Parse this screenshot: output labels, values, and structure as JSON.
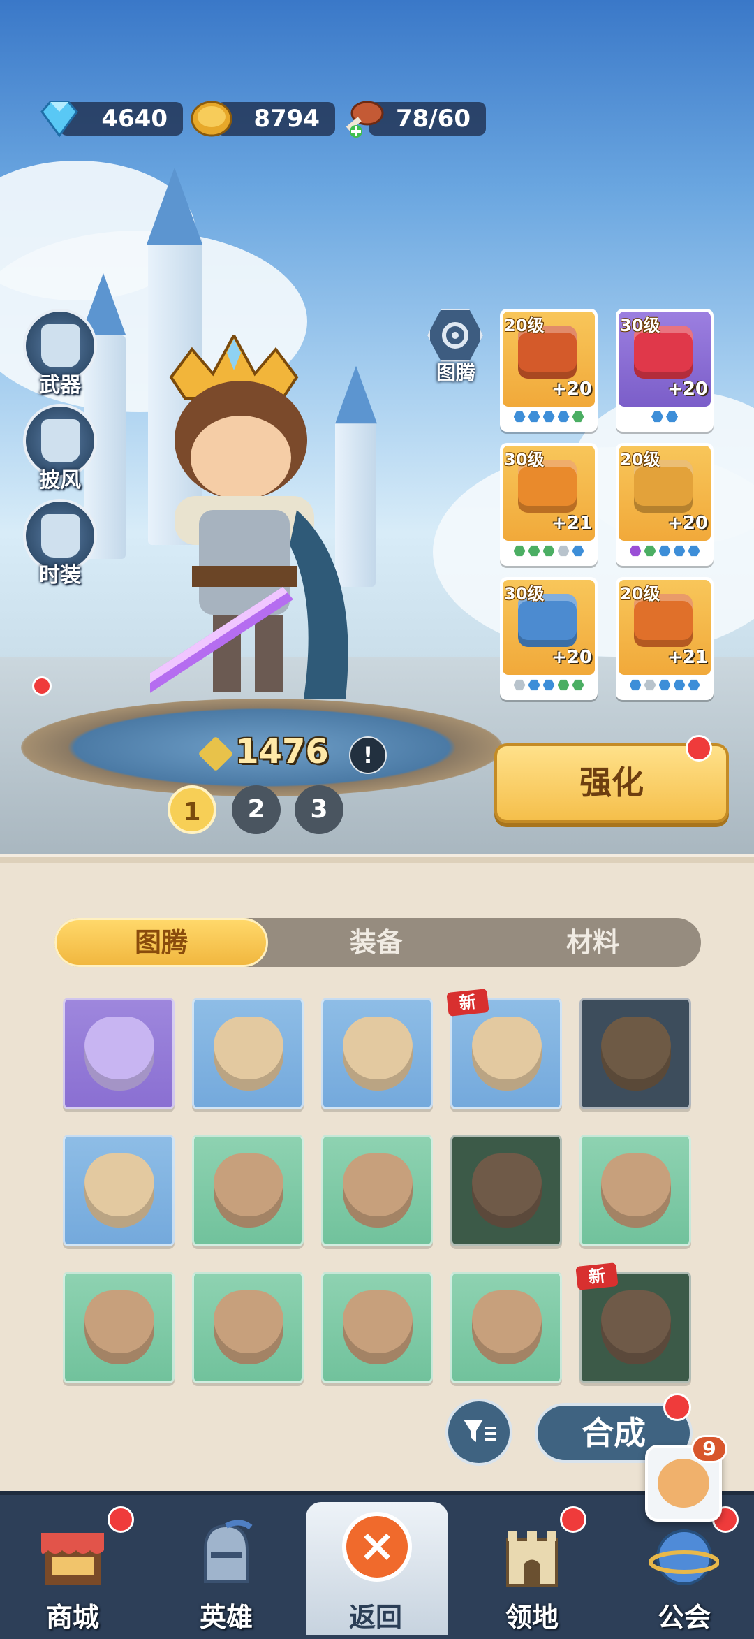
{
  "resources": {
    "gems": "4640",
    "coins": "8794",
    "stamina": "78/60"
  },
  "side_menu": {
    "weapon": "武器",
    "cape": "披风",
    "outfit": "时装"
  },
  "totem_button": {
    "label": "图腾"
  },
  "equipment": [
    {
      "level": "20级",
      "plus": "+20",
      "rarity": "gold",
      "gems": [
        "blue",
        "blue",
        "blue",
        "blue",
        "green"
      ]
    },
    {
      "level": "30级",
      "plus": "+20",
      "rarity": "purple",
      "gems": [
        "blue",
        "blue"
      ]
    },
    {
      "level": "30级",
      "plus": "+21",
      "rarity": "gold",
      "gems": [
        "green",
        "green",
        "green",
        "grey",
        "blue"
      ]
    },
    {
      "level": "20级",
      "plus": "+20",
      "rarity": "gold",
      "gems": [
        "purple",
        "green",
        "blue",
        "blue",
        "blue"
      ]
    },
    {
      "level": "30级",
      "plus": "+20",
      "rarity": "gold",
      "gems": [
        "grey",
        "blue",
        "blue",
        "green",
        "green"
      ]
    },
    {
      "level": "20级",
      "plus": "+21",
      "rarity": "gold",
      "gems": [
        "blue",
        "grey",
        "blue",
        "blue",
        "blue"
      ]
    }
  ],
  "hero": {
    "power": "1476",
    "warning": "!",
    "pages": [
      "1",
      "2",
      "3"
    ],
    "active_page": "1"
  },
  "strengthen_button": "强化",
  "tabs": {
    "totem": "图腾",
    "equipment": "装备",
    "materials": "材料",
    "active": "totem"
  },
  "new_tag": "新",
  "combine_button": "合成",
  "guild_badge": "9",
  "nav": {
    "shop": "商城",
    "heroes": "英雄",
    "back": "返回",
    "territory": "领地",
    "guild": "公会"
  },
  "colors": {
    "accent_gold": "#f5bf4b",
    "panel_bg": "#ece2d2",
    "nav_bg": "#2d3f58",
    "notification_red": "#ef3b3b"
  }
}
